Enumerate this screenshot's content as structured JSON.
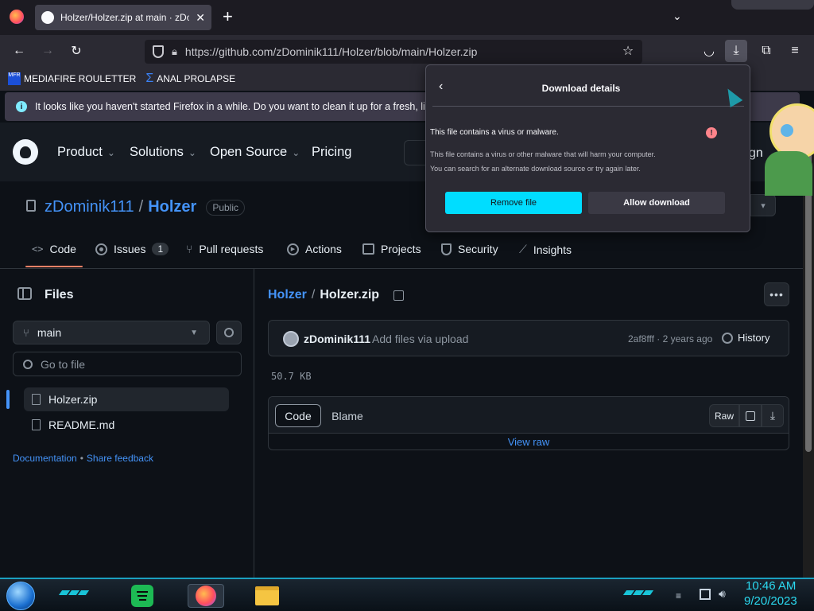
{
  "browser": {
    "tab_title": "Holzer/Holzer.zip at main · zDo",
    "new_tab": "+",
    "url": "https://github.com/zDominik111/Holzer/blob/main/Holzer.zip",
    "bookmarks": [
      {
        "label": "MEDIAFIRE ROULETTER",
        "icon": "MFR"
      },
      {
        "label": "ANAL PROLAPSE"
      }
    ],
    "notice": "It looks like you haven't started Firefox in a while. Do you want to clean it up for a fresh, like-n"
  },
  "download_popup": {
    "title": "Download details",
    "warning_title": "This file contains a virus or malware.",
    "warning_line1": "This file contains a virus or other malware that will harm your computer.",
    "warning_line2": "You can search for an alternate download source or try again later.",
    "remove_label": "Remove file",
    "allow_label": "Allow download",
    "accent": "#00ddff",
    "danger": "#ff848b"
  },
  "github": {
    "nav": [
      "Product",
      "Solutions",
      "Open Source",
      "Pricing"
    ],
    "sign_partial": "gn",
    "owner": "zDominik111",
    "separator": "/",
    "repo": "Holzer",
    "visibility": "Public",
    "tabs": [
      {
        "label": "Code",
        "icon": "code-icon"
      },
      {
        "label": "Issues",
        "icon": "issue-icon",
        "count": "1"
      },
      {
        "label": "Pull requests",
        "icon": "pull-request-icon"
      },
      {
        "label": "Actions",
        "icon": "play-icon"
      },
      {
        "label": "Projects",
        "icon": "table-icon"
      },
      {
        "label": "Security",
        "icon": "shield-icon"
      },
      {
        "label": "Insights",
        "icon": "graph-icon"
      }
    ],
    "files_heading": "Files",
    "branch": "main",
    "goto_placeholder": "Go to file",
    "files": [
      "Holzer.zip",
      "README.md"
    ],
    "documentation": "Documentation",
    "bullet": "•",
    "share_feedback": "Share feedback",
    "breadcrumb_repo": "Holzer",
    "breadcrumb_file": "Holzer.zip",
    "commit_author": "zDominik111",
    "commit_message": "Add files via upload",
    "commit_meta": "2af8fff · 2 years ago",
    "history_label": "History",
    "file_size": "50.7 KB",
    "code_label": "Code",
    "blame_label": "Blame",
    "raw_label": "Raw",
    "view_raw": "View raw"
  },
  "taskbar": {
    "time": "10:46 AM",
    "date": "9/20/2023"
  }
}
